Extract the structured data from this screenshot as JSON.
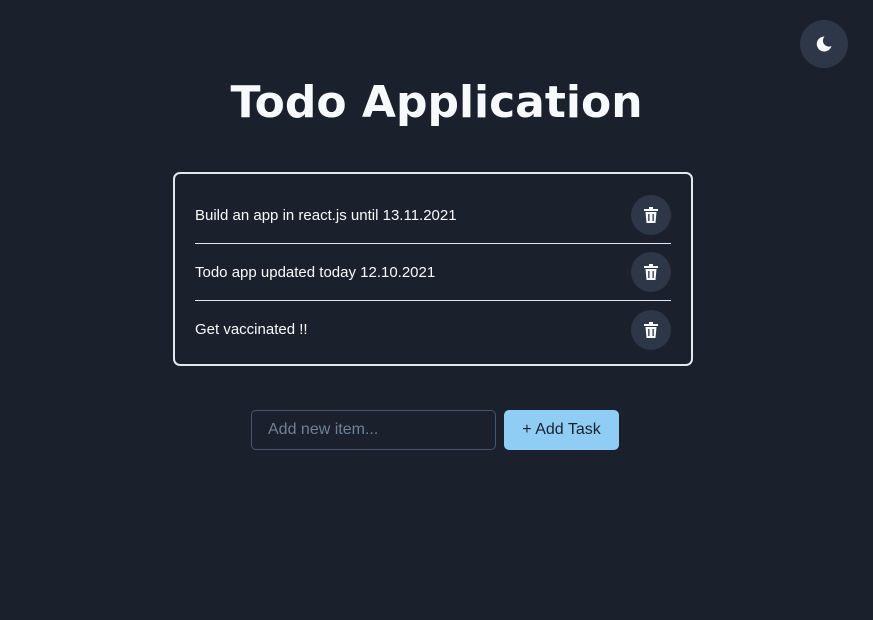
{
  "app": {
    "title": "Todo Application"
  },
  "theme_toggle": {
    "icon": "moon-icon"
  },
  "todos": [
    {
      "text": "Build an app in react.js until 13.11.2021",
      "delete_icon": "trash-icon"
    },
    {
      "text": "Todo app updated today 12.10.2021",
      "delete_icon": "trash-icon"
    },
    {
      "text": "Get vaccinated !!",
      "delete_icon": "trash-icon"
    }
  ],
  "add_form": {
    "value": "",
    "placeholder": "Add new item...",
    "button_label": "+ Add Task"
  },
  "colors": {
    "background": "#1a202c",
    "button_bg": "#2d3748",
    "accent": "#90cdf4",
    "text": "#f7fafc",
    "border": "#e2e8f0"
  }
}
